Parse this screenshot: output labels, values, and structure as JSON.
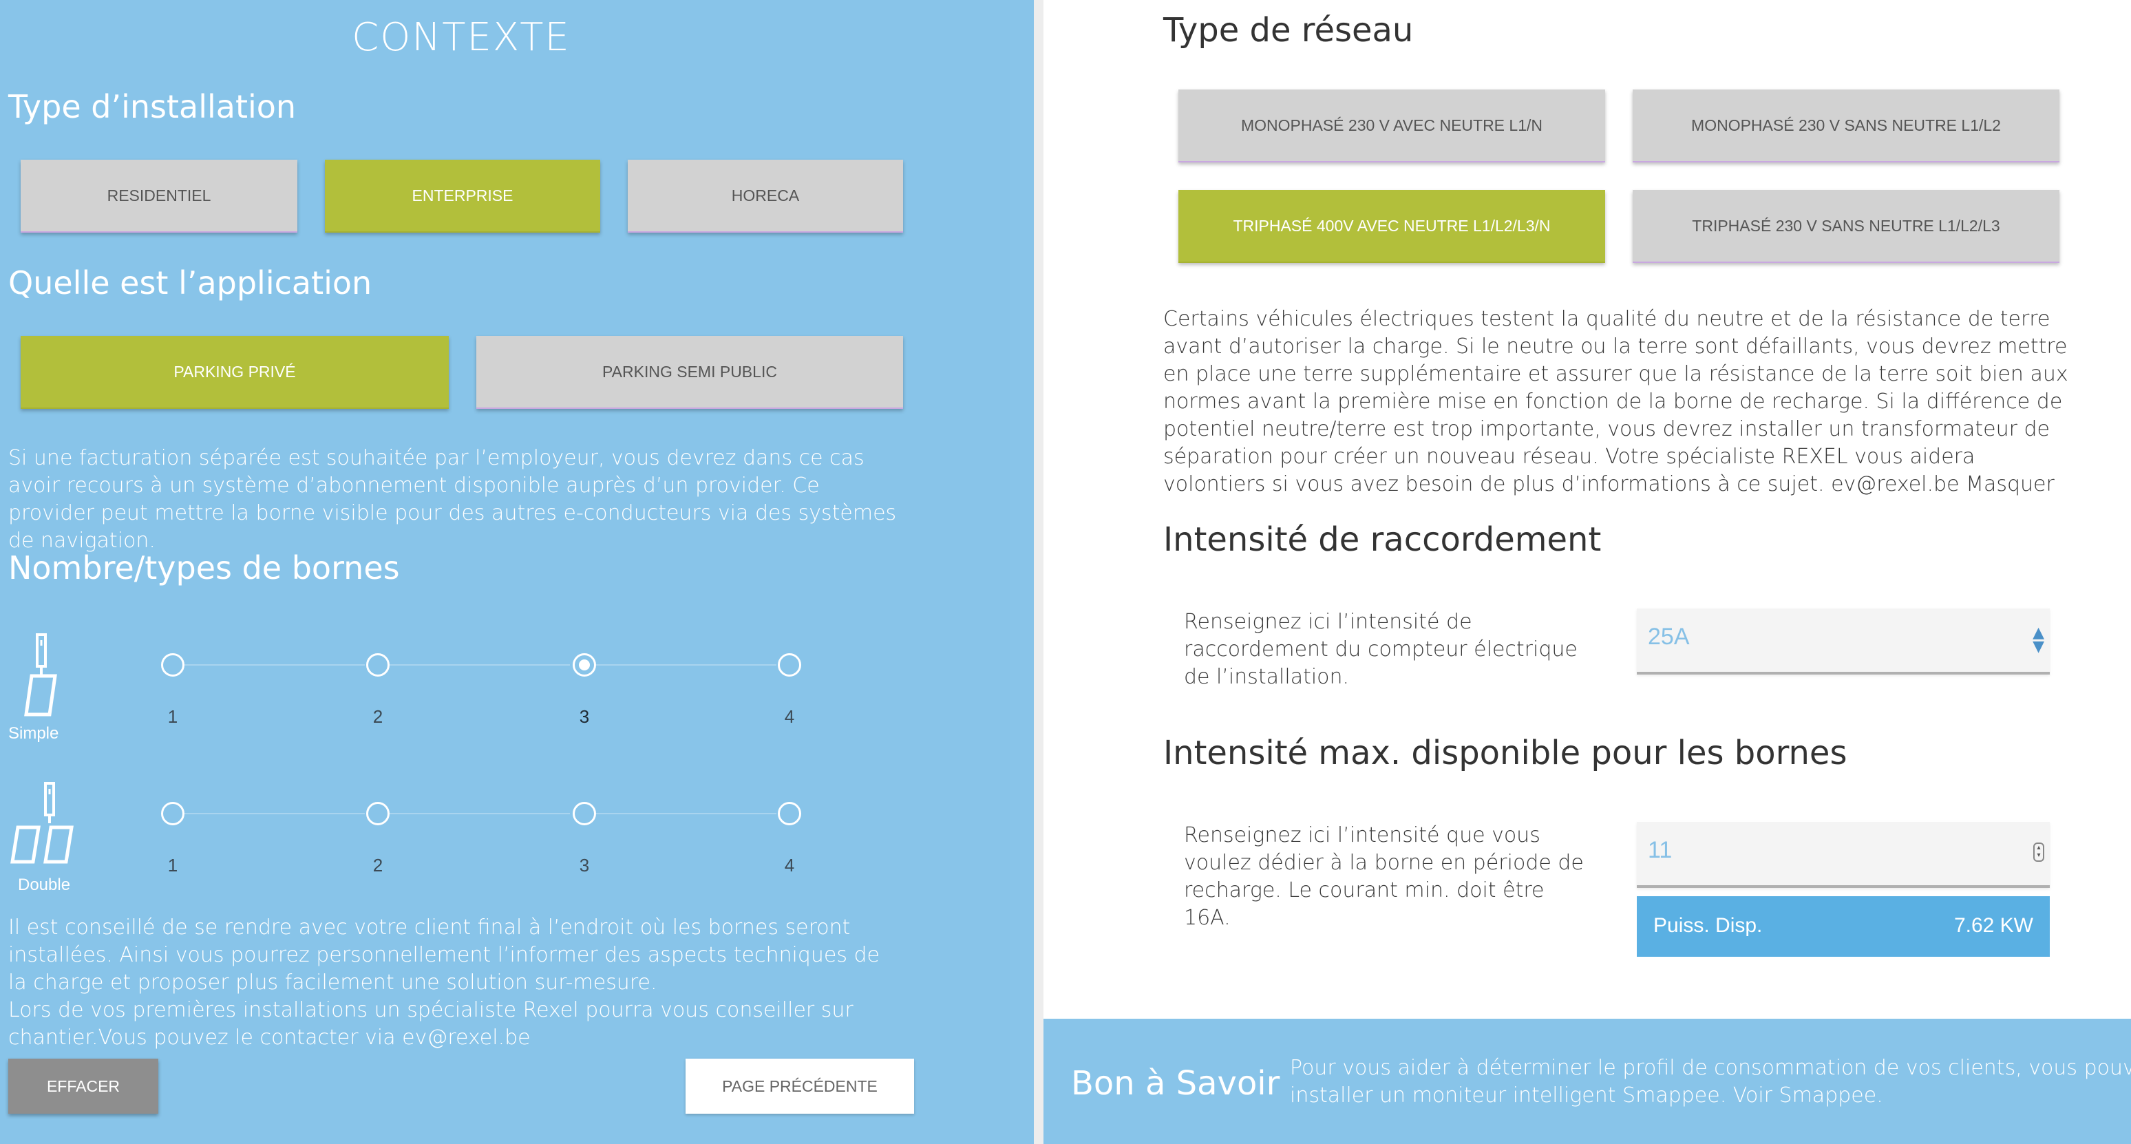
{
  "left": {
    "title": "CONTEXTE",
    "installation": {
      "heading": "Type d’installation",
      "options": [
        "RESIDENTIEL",
        "ENTERPRISE",
        "HORECA"
      ],
      "selected": "ENTERPRISE"
    },
    "application": {
      "heading": "Quelle est l’application",
      "options": [
        "PARKING PRIVÉ",
        "PARKING SEMI PUBLIC"
      ],
      "selected": "PARKING PRIVÉ"
    },
    "application_note": "Si une facturation séparée est souhaitée par l’employeur, vous devrez dans ce cas avoir recours à un système d’abonnement disponible auprès d’un provider. Ce provider peut mettre la borne visible pour des autres e-conducteurs via des systèmes de navigation.",
    "bornes": {
      "heading": "Nombre/types de bornes",
      "simple": {
        "label": "Simple",
        "values": [
          "1",
          "2",
          "3",
          "4"
        ],
        "selected": "3"
      },
      "double": {
        "label": "Double",
        "values": [
          "1",
          "2",
          "3",
          "4"
        ],
        "selected": null
      }
    },
    "advice": "Il est conseillé de se rendre avec votre client final à l’endroit où les bornes seront installées. Ainsi vous pourrez personnellement l’informer des aspects techniques de la charge et proposer plus facilement une solution sur-mesure.",
    "advice2": "Lors de vos premières installations un spécialiste Rexel pourra vous conseiller sur chantier.Vous pouvez le contacter via ev@rexel.be",
    "effacer_label": "EFFACER",
    "prev_label": "PAGE PRÉCÉDENTE"
  },
  "right": {
    "reseau": {
      "heading": "Type de réseau",
      "options": [
        "MONOPHASÉ 230 V AVEC NEUTRE L1/N",
        "MONOPHASÉ 230 V SANS NEUTRE L1/L2",
        "TRIPHASÉ 400V AVEC NEUTRE L1/L2/L3/N",
        "TRIPHASÉ 230 V SANS NEUTRE L1/L2/L3"
      ],
      "selected": "TRIPHASÉ 400V AVEC NEUTRE L1/L2/L3/N"
    },
    "reseau_note": "Certains véhicules électriques testent la qualité du neutre et de la résistance de terre avant d’autoriser la charge. Si le neutre ou la terre sont défaillants, vous devrez mettre en place une terre supplémentaire et assurer que la résistance de la terre soit bien aux normes avant la première mise en fonction de la borne de recharge. Si la différence de potentiel neutre/terre est trop importante, vous devrez installer un transformateur de séparation pour créer un nouveau réseau. Votre spécialiste REXEL vous aidera volontiers si vous avez besoin de plus d’informations à ce sujet. ev@rexel.be Masquer",
    "raccordement": {
      "heading": "Intensité de raccordement",
      "label": "Renseignez ici l’intensité de raccordement du compteur électrique de l’installation.",
      "value": "25A"
    },
    "max": {
      "heading": "Intensité max. disponible pour les bornes",
      "label": "Renseignez ici l’intensité que vous voulez dédier à la borne en période de recharge. Le courant min. doit être 16A.",
      "value": "11",
      "puiss_label": "Puiss. Disp.",
      "puiss_value": "7.62 KW"
    },
    "bon": {
      "title": "Bon à Savoir",
      "line1": "Pour vous aider à déterminer le profil de consommation de vos clients, vous pouvez",
      "line2": "installer un moniteur intelligent Smappee. Voir Smappee."
    }
  }
}
